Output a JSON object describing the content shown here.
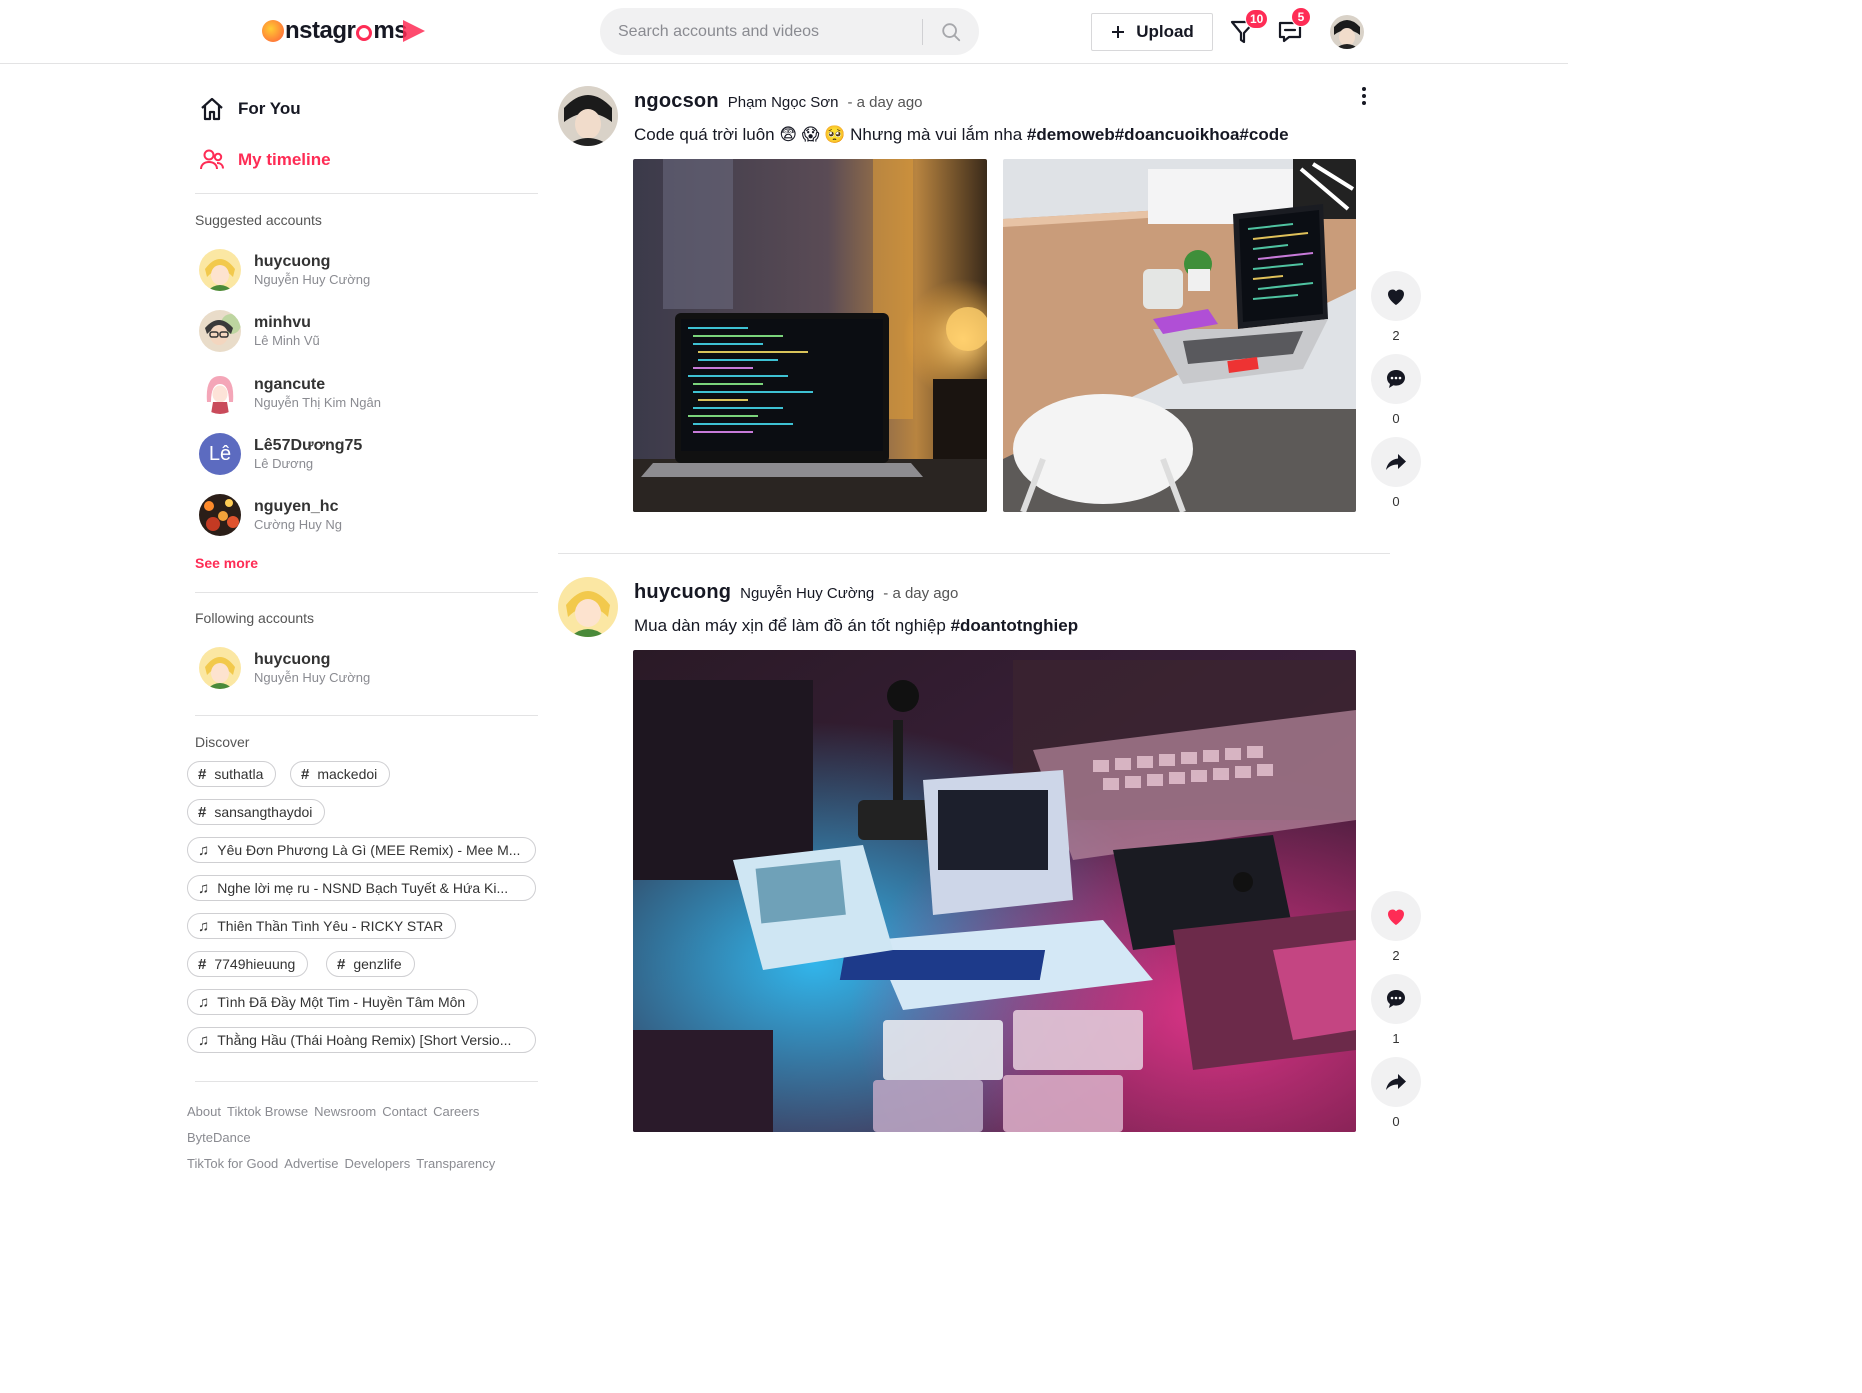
{
  "brand": {
    "logo_text": "nstagr",
    "logo_text2": "ms",
    "accent": "#fe2c55"
  },
  "search": {
    "placeholder": "Search accounts and videos"
  },
  "header": {
    "upload_label": "Upload",
    "inbox_badge": "10",
    "messages_badge": "5"
  },
  "nav": {
    "for_you": "For You",
    "my_timeline": "My timeline"
  },
  "suggested": {
    "title": "Suggested accounts",
    "accounts": [
      {
        "username": "huycuong",
        "fullname": "Nguyễn Huy Cường"
      },
      {
        "username": "minhvu",
        "fullname": "Lê Minh Vũ"
      },
      {
        "username": "ngancute",
        "fullname": "Nguyễn Thị Kim Ngân"
      },
      {
        "username": "Lê57Dương75",
        "fullname": "Lê Dương",
        "initial": "Lê"
      },
      {
        "username": "nguyen_hc",
        "fullname": "Cường Huy Ng"
      }
    ],
    "see_more": "See more"
  },
  "following": {
    "title": "Following accounts",
    "accounts": [
      {
        "username": "huycuong",
        "fullname": "Nguyễn Huy Cường"
      }
    ]
  },
  "discover": {
    "title": "Discover",
    "tags": [
      {
        "kind": "hashtag",
        "label": "suthatla"
      },
      {
        "kind": "hashtag",
        "label": "mackedoi"
      },
      {
        "kind": "hashtag",
        "label": "sansangthaydoi"
      },
      {
        "kind": "music",
        "label": "Yêu Đơn Phương Là Gì (MEE Remix) - Mee M..."
      },
      {
        "kind": "music",
        "label": "Nghe lời mẹ ru - NSND Bạch Tuyết & Hứa Ki..."
      },
      {
        "kind": "music",
        "label": "Thiên Thần Tình Yêu - RICKY STAR"
      },
      {
        "kind": "hashtag",
        "label": "7749hieuung"
      },
      {
        "kind": "hashtag",
        "label": "genzlife"
      },
      {
        "kind": "music",
        "label": "Tình Đã Đầy Một Tim - Huyền Tâm Môn"
      },
      {
        "kind": "music",
        "label": "Thằng Hầu (Thái Hoàng Remix) [Short Versio..."
      }
    ]
  },
  "footer": {
    "line1": [
      "About",
      "Tiktok Browse",
      "Newsroom",
      "Contact",
      "Careers"
    ],
    "line2": [
      "ByteDance"
    ],
    "line3": [
      "TikTok for Good",
      "Advertise",
      "Developers",
      "Transparency"
    ]
  },
  "posts": [
    {
      "username": "ngocson",
      "fullname": "Phạm Ngọc Sơn",
      "time": "a day ago",
      "caption_text": "Code quá trời luôn 😨 😱 🥺  Nhưng mà vui lắm nha ",
      "caption_tags": "#demoweb#doancuoikhoa#code",
      "likes": "2",
      "comments": "0",
      "shares": "0",
      "liked": false
    },
    {
      "username": "huycuong",
      "fullname": "Nguyễn Huy Cường",
      "time": "a day ago",
      "caption_text": "Mua dàn máy xịn để làm đồ án tốt nghiệp ",
      "caption_tags": "#doantotnghiep",
      "likes": "2",
      "comments": "1",
      "shares": "0",
      "liked": true
    }
  ],
  "icons": {
    "search": "search-icon",
    "plus": "plus-icon",
    "inbox": "filter-send-icon",
    "messages": "message-icon",
    "home": "home-icon",
    "timeline": "users-icon",
    "hashtag": "hashtag-icon",
    "music": "music-note-icon",
    "heart": "heart-icon",
    "comment": "comment-icon",
    "share": "share-icon",
    "more": "more-vertical-icon"
  }
}
